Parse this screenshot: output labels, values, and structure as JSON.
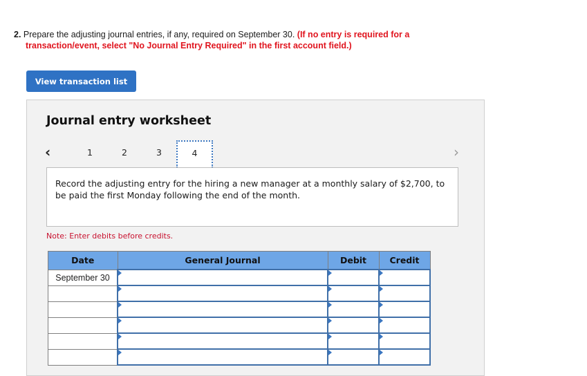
{
  "question": {
    "number": "2.",
    "text": "Prepare the adjusting journal entries, if any, required on September 30.",
    "instruction_part1": "(If no entry is required for a",
    "instruction_part2": "transaction/event, select \"No Journal Entry Required\" in the first account field.)"
  },
  "view_button": {
    "label": "View transaction list"
  },
  "worksheet": {
    "title": "Journal entry worksheet",
    "nav": {
      "prev_icon": "‹",
      "next_icon": "›",
      "pages": [
        "1",
        "2",
        "3",
        "4"
      ],
      "active_page": "4"
    },
    "description": "Record the adjusting entry for the hiring a new manager at a monthly salary of $2,700, to be paid the first Monday following the end of the month.",
    "note": "Note: Enter debits before credits.",
    "table": {
      "headers": {
        "date": "Date",
        "general_journal": "General Journal",
        "debit": "Debit",
        "credit": "Credit"
      },
      "rows": [
        {
          "date": "September 30",
          "account": "",
          "debit": "",
          "credit": ""
        },
        {
          "date": "",
          "account": "",
          "debit": "",
          "credit": ""
        },
        {
          "date": "",
          "account": "",
          "debit": "",
          "credit": ""
        },
        {
          "date": "",
          "account": "",
          "debit": "",
          "credit": ""
        },
        {
          "date": "",
          "account": "",
          "debit": "",
          "credit": ""
        },
        {
          "date": "",
          "account": "",
          "debit": "",
          "credit": ""
        }
      ]
    }
  }
}
